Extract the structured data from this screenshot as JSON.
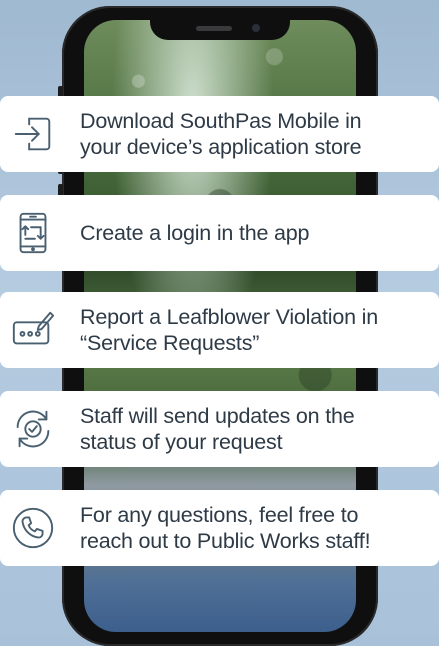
{
  "steps": [
    {
      "icon": "login-arrow-icon",
      "lines": [
        "Download SouthPas Mobile in",
        "your device’s application store"
      ]
    },
    {
      "icon": "phone-transfer-icon",
      "lines": [
        "Create a login in the app"
      ]
    },
    {
      "icon": "form-edit-icon",
      "lines": [
        "Report a Leafblower Violation in",
        "“Service Requests”"
      ]
    },
    {
      "icon": "refresh-check-icon",
      "lines": [
        "Staff will send updates on the",
        "status of your request"
      ]
    },
    {
      "icon": "phone-call-icon",
      "lines": [
        "For any questions, feel free to",
        "reach out to Public Works staff!"
      ]
    }
  ],
  "colors": {
    "background": "#a8c1d8",
    "card": "#ffffff",
    "text": "#2e3b47",
    "icon": "#4a6070"
  }
}
